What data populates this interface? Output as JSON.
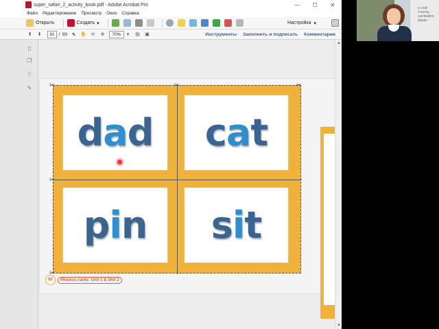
{
  "window": {
    "title": "super_safari_2_activity_book.pdf - Adobe Acrobat Pro",
    "minimize": "—",
    "maximize": "☐",
    "close": "✕"
  },
  "menu": [
    "Файл",
    "Редактирование",
    "Просмотр",
    "Окно",
    "Справка"
  ],
  "toolbar": {
    "open_label": "Открыть",
    "create_label": "Создать",
    "create_arrow": "▾",
    "settings_label": "Настройка",
    "settings_arrow": "▾"
  },
  "nav": {
    "current_page": "81",
    "separator": "/",
    "total_pages": "93",
    "zoom": "70%",
    "zoom_arrow": "▾",
    "tools_link": "Инструменты",
    "fill_sign_link": "Заполнить и подписать",
    "comments_link": "Комментарии"
  },
  "document": {
    "cards": [
      {
        "parts": [
          "d",
          "a",
          "d"
        ]
      },
      {
        "parts": [
          "c",
          "a",
          "t"
        ]
      },
      {
        "parts": [
          "p",
          "i",
          "n"
        ]
      },
      {
        "parts": [
          "s",
          "i",
          "t"
        ]
      }
    ],
    "page_number": "82",
    "footer_text": "Phonics cards: Unit 1 & Unit 2"
  },
  "webcam": {
    "overlay_text": "С НАЙ УЧУАТЬ АНГЛИЙСК ЯЗЫК!"
  },
  "colors": {
    "card_border_orange": "#f0b23a",
    "word_blue": "#3b6591",
    "vowel_blue": "#2e8fcf",
    "acrobat_red": "#c8102e",
    "link_blue": "#3a5f8c"
  }
}
